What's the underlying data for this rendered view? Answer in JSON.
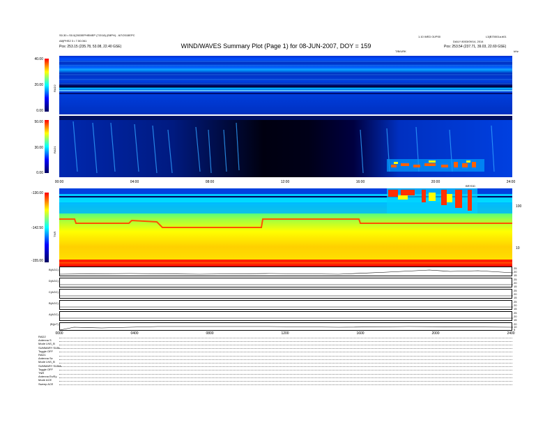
{
  "header": {
    "left_line1": "S0.30 • S0.0(2003EPHEMEP (7/2/18) (E8PH) - 6/7/2015EPC",
    "left_line2": "A8(PHS2 3 • 7.50.061",
    "left_line3_label": "Pos:",
    "left_line3_value": "253.15 (235.78, 53.08, 22.40 GSE)",
    "right_line1": "1.10 WED 01/P00",
    "right_line2": "L3(B70001a.b01",
    "right_line3": "DAILY 8003/09/14, 2014",
    "right_line4_label": "Pos:",
    "right_line4_value": "253.54 (237.71, 39.03, 22.69 GSE)",
    "tiny_center": "T/B/URK",
    "tiny_right": "kHz"
  },
  "title": "WIND/WAVES Summary Plot (Page 1) for 08-JUN-2007, DOY = 159",
  "colors": {
    "background": "#ffffff",
    "spectrum_dark": "#000080",
    "spectrum_mid": "#0040ff",
    "spectrum_high": "#ff2000"
  },
  "panels": {
    "rad2": {
      "label": "RAD2",
      "ticks": [
        "40.00",
        "20.00",
        "0.00"
      ]
    },
    "rad1": {
      "label": "RAD1",
      "ticks": [
        "50.00",
        "30.00",
        "0.00"
      ]
    },
    "tnr": {
      "label": "TNR",
      "ticks": [
        "-130.00",
        "-142.50",
        "-155.00"
      ],
      "right_ticks": [
        "100",
        "10"
      ],
      "tiny_label": "BRYDD"
    }
  },
  "xaxis_top": [
    "00:00",
    "04:00",
    "08:00",
    "12:00",
    "16:00",
    "20:00",
    "24:00"
  ],
  "xaxis_bottom": [
    "0000",
    "0400",
    "0800",
    "1200",
    "1600",
    "2000",
    "2400"
  ],
  "timelines": [
    {
      "label": "B(AGC)",
      "right": [
        "25",
        "20",
        "15"
      ]
    },
    {
      "label": "D(AGC)",
      "right": [
        "25",
        "20",
        "15"
      ]
    },
    {
      "label": "C(AGC)",
      "right": [
        "25",
        "20",
        "15"
      ]
    },
    {
      "label": "B(AGC)",
      "right": [
        "25",
        "20",
        "15"
      ]
    },
    {
      "label": "A(AGC)",
      "right": [
        "25",
        "20",
        "15"
      ]
    },
    {
      "label": "|B|(nT)",
      "right": [
        "20",
        "10",
        "5"
      ]
    }
  ],
  "modes": [
    "RAD2",
    "Antenna  S",
    "Mode    LNS_B",
    "SUMMARY  SUM",
    "Toggle   OFF",
    "RAD1",
    "Antenna  Sz",
    "Mode    LNS_B",
    "SUMMARY  SUMA",
    "Toggle   OFF",
    "TNR",
    "Antenna  Ex/Ey",
    "Mode    ACE",
    "Sweep    ACE"
  ],
  "chart_data": {
    "type": "heatmap",
    "title": "WIND/WAVES Summary Plot (Page 1) for 08-JUN-2007, DOY = 159",
    "x_range_hours": [
      0,
      24
    ],
    "xtick_labels": [
      "00:00",
      "04:00",
      "08:00",
      "12:00",
      "16:00",
      "20:00",
      "24:00"
    ],
    "panels": [
      {
        "name": "RAD2",
        "colorbar_range": [
          0,
          40
        ]
      },
      {
        "name": "RAD1",
        "colorbar_range": [
          0,
          50
        ]
      },
      {
        "name": "TNR",
        "colorbar_range": [
          -155,
          -130
        ],
        "right_axis_log": true,
        "right_ticks": [
          100,
          10
        ]
      }
    ],
    "timeline_series": [
      "B(AGC)",
      "D(AGC)",
      "C(AGC)",
      "B(AGC)",
      "A(AGC)",
      "|B|(nT)"
    ]
  }
}
